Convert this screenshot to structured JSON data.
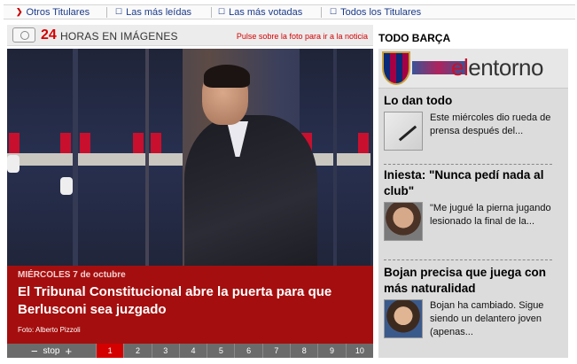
{
  "topnav": {
    "items": [
      {
        "label": "Otros Titulares",
        "icon": "chevron-down-icon"
      },
      {
        "label": "Las más leídas",
        "icon": "list-icon"
      },
      {
        "label": "Las más votadas",
        "icon": "list-icon"
      },
      {
        "label": "Todos los Titulares",
        "icon": "list-icon"
      }
    ]
  },
  "gallery": {
    "number": "24",
    "title": "HORAS EN IMÁGENES",
    "hint": "Pulse sobre la foto para ir a la noticia",
    "date_day": "MIÉRCOLES",
    "date_rest": "7 de octubre",
    "headline": "El Tribunal Constitucional abre la puerta para que Berlusconi sea juzgado",
    "credit": "Foto: Alberto Pizzoli",
    "controls": {
      "minus": "−",
      "stop": "stop",
      "plus": "+"
    },
    "pages": [
      "1",
      "2",
      "3",
      "4",
      "5",
      "6",
      "7",
      "8",
      "9",
      "10"
    ],
    "active_page": 1
  },
  "sidebar": {
    "title": "TODO BARÇA",
    "brand_el": "el",
    "brand_rest": "entorno",
    "stories": [
      {
        "title": "Lo dan todo",
        "text": "Este miércoles dio rueda de prensa después del..."
      },
      {
        "title": "Iniesta: \"Nunca pedí nada al club\"",
        "text": "\"Me jugué la pierna jugando lesionado la final de la..."
      },
      {
        "title": "Bojan precisa que juega con más naturalidad",
        "text": "Bojan ha cambiado. Sigue siendo un delantero joven (apenas..."
      }
    ]
  },
  "colors": {
    "accent": "#d40000",
    "caption_bg": "#a50e0e",
    "link": "#1a3a8a"
  }
}
